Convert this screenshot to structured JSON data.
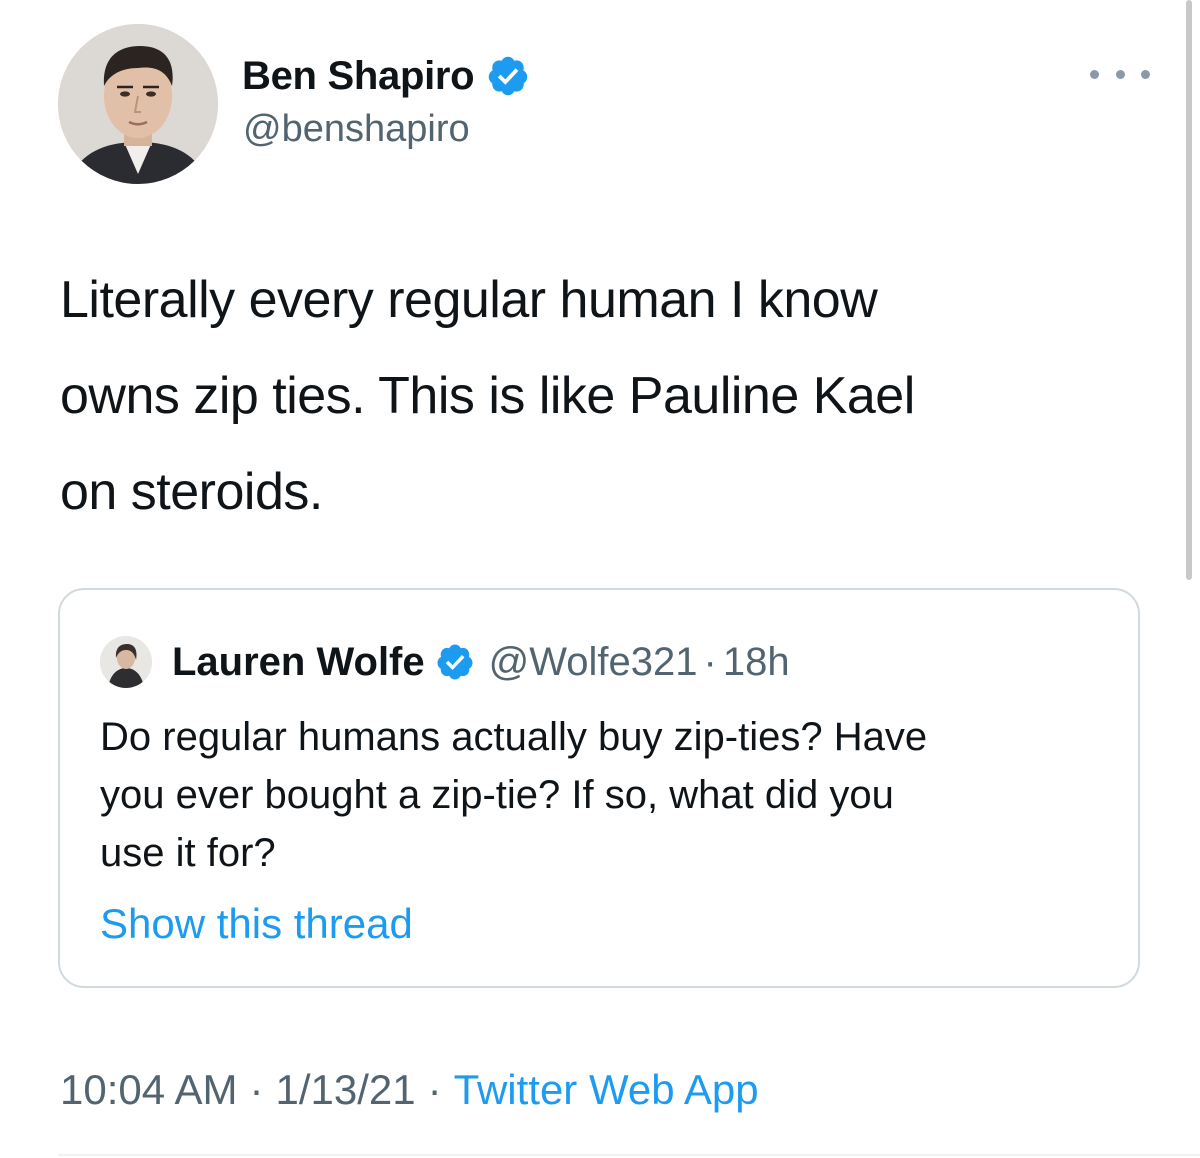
{
  "tweet": {
    "author": {
      "display_name": "Ben Shapiro",
      "handle": "@benshapiro",
      "verified": true
    },
    "text_lines": [
      "Literally every regular human I know",
      "owns zip ties. This is like Pauline Kael",
      "on steroids."
    ],
    "quoted": {
      "author": {
        "display_name": "Lauren Wolfe",
        "handle": "@Wolfe321",
        "verified": true
      },
      "separator": "·",
      "time_ago": "18h",
      "text_lines": [
        "Do regular humans actually buy zip-ties? Have",
        "you ever bought a zip-tie? If so, what did you",
        "use it for?"
      ],
      "show_thread_label": "Show this thread"
    },
    "meta": {
      "time": "10:04 AM",
      "date": "1/13/21",
      "source": "Twitter Web App",
      "separator": "·"
    }
  },
  "icons": {
    "verified": "verified-badge-icon",
    "more": "more-horizontal-icon"
  },
  "colors": {
    "accent": "#1d9bf0",
    "text_primary": "#0f1419",
    "text_secondary": "#536471",
    "border": "#cfd9de"
  }
}
